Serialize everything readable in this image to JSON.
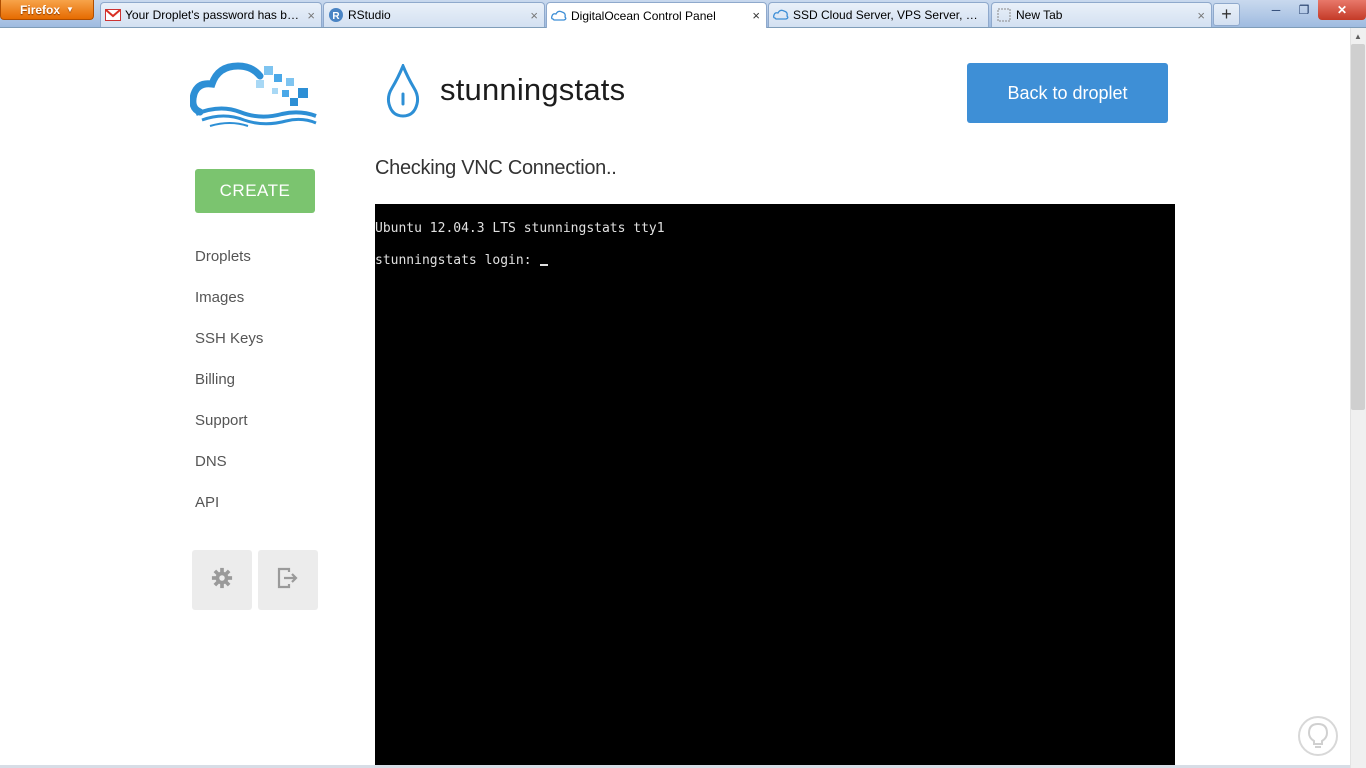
{
  "browser": {
    "menu_label": "Firefox",
    "tabs": [
      {
        "title": "Your Droplet's password has be...",
        "icon": "gmail-icon",
        "active": false
      },
      {
        "title": "RStudio",
        "icon": "rstudio-icon",
        "active": false
      },
      {
        "title": "DigitalOcean Control Panel",
        "icon": "digitalocean-icon",
        "active": true
      },
      {
        "title": "SSD Cloud Server, VPS Server, Si...",
        "icon": "digitalocean-icon",
        "active": false
      },
      {
        "title": "New Tab",
        "icon": "blank-page-icon",
        "active": false
      }
    ],
    "close_glyph": "×",
    "new_tab_glyph": "+"
  },
  "sidebar": {
    "create_label": "CREATE",
    "items": [
      {
        "label": "Droplets"
      },
      {
        "label": "Images"
      },
      {
        "label": "SSH Keys"
      },
      {
        "label": "Billing"
      },
      {
        "label": "Support"
      },
      {
        "label": "DNS"
      },
      {
        "label": "API"
      }
    ],
    "settings_icon": "gear-icon",
    "logout_icon": "logout-icon"
  },
  "header": {
    "droplet_name": "stunningstats",
    "back_label": "Back to droplet"
  },
  "vnc": {
    "status": "Checking VNC Connection..",
    "lines": [
      "Ubuntu 12.04.3 LTS stunningstats tty1",
      "stunningstats login: "
    ]
  },
  "colors": {
    "create_green": "#7bc46f",
    "primary_blue": "#3e8fd6",
    "console_bg": "#000000"
  }
}
